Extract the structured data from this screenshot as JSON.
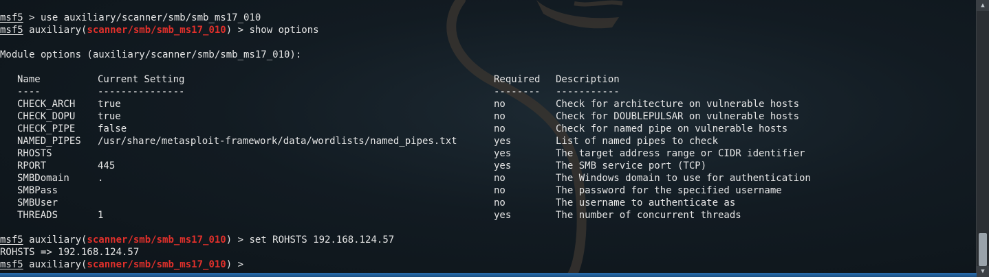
{
  "prompt": {
    "msf": "msf5",
    "aux_prefix": " auxiliary(",
    "module": "scanner/smb/smb_ms17_010",
    "aux_suffix": ") > "
  },
  "lines": {
    "cmd1": " > use auxiliary/scanner/smb/smb_ms17_010",
    "cmd2": "show options",
    "module_options": "Module options (auxiliary/scanner/smb/smb_ms17_010):",
    "cmd3": "set ROHSTS 192.168.124.57",
    "cmd3_output": "ROHSTS => 192.168.124.57"
  },
  "table": {
    "headers": [
      "Name",
      "Current Setting",
      "Required",
      "Description"
    ],
    "dashes": [
      "----",
      "---------------",
      "--------",
      "-----------"
    ],
    "rows": [
      [
        "CHECK_ARCH",
        "true",
        "no",
        "Check for architecture on vulnerable hosts"
      ],
      [
        "CHECK_DOPU",
        "true",
        "no",
        "Check for DOUBLEPULSAR on vulnerable hosts"
      ],
      [
        "CHECK_PIPE",
        "false",
        "no",
        "Check for named pipe on vulnerable hosts"
      ],
      [
        "NAMED_PIPES",
        "/usr/share/metasploit-framework/data/wordlists/named_pipes.txt",
        "yes",
        "List of named pipes to check"
      ],
      [
        "RHOSTS",
        "",
        "yes",
        "The target address range or CIDR identifier"
      ],
      [
        "RPORT",
        "445",
        "yes",
        "The SMB service port (TCP)"
      ],
      [
        "SMBDomain",
        ".",
        "no",
        "The Windows domain to use for authentication"
      ],
      [
        "SMBPass",
        "",
        "no",
        "The password for the specified username"
      ],
      [
        "SMBUser",
        "",
        "no",
        "The username to authenticate as"
      ],
      [
        "THREADS",
        "1",
        "yes",
        "The number of concurrent threads"
      ]
    ]
  },
  "icons": {
    "scroll_up": "▲",
    "scroll_down": "▼"
  }
}
